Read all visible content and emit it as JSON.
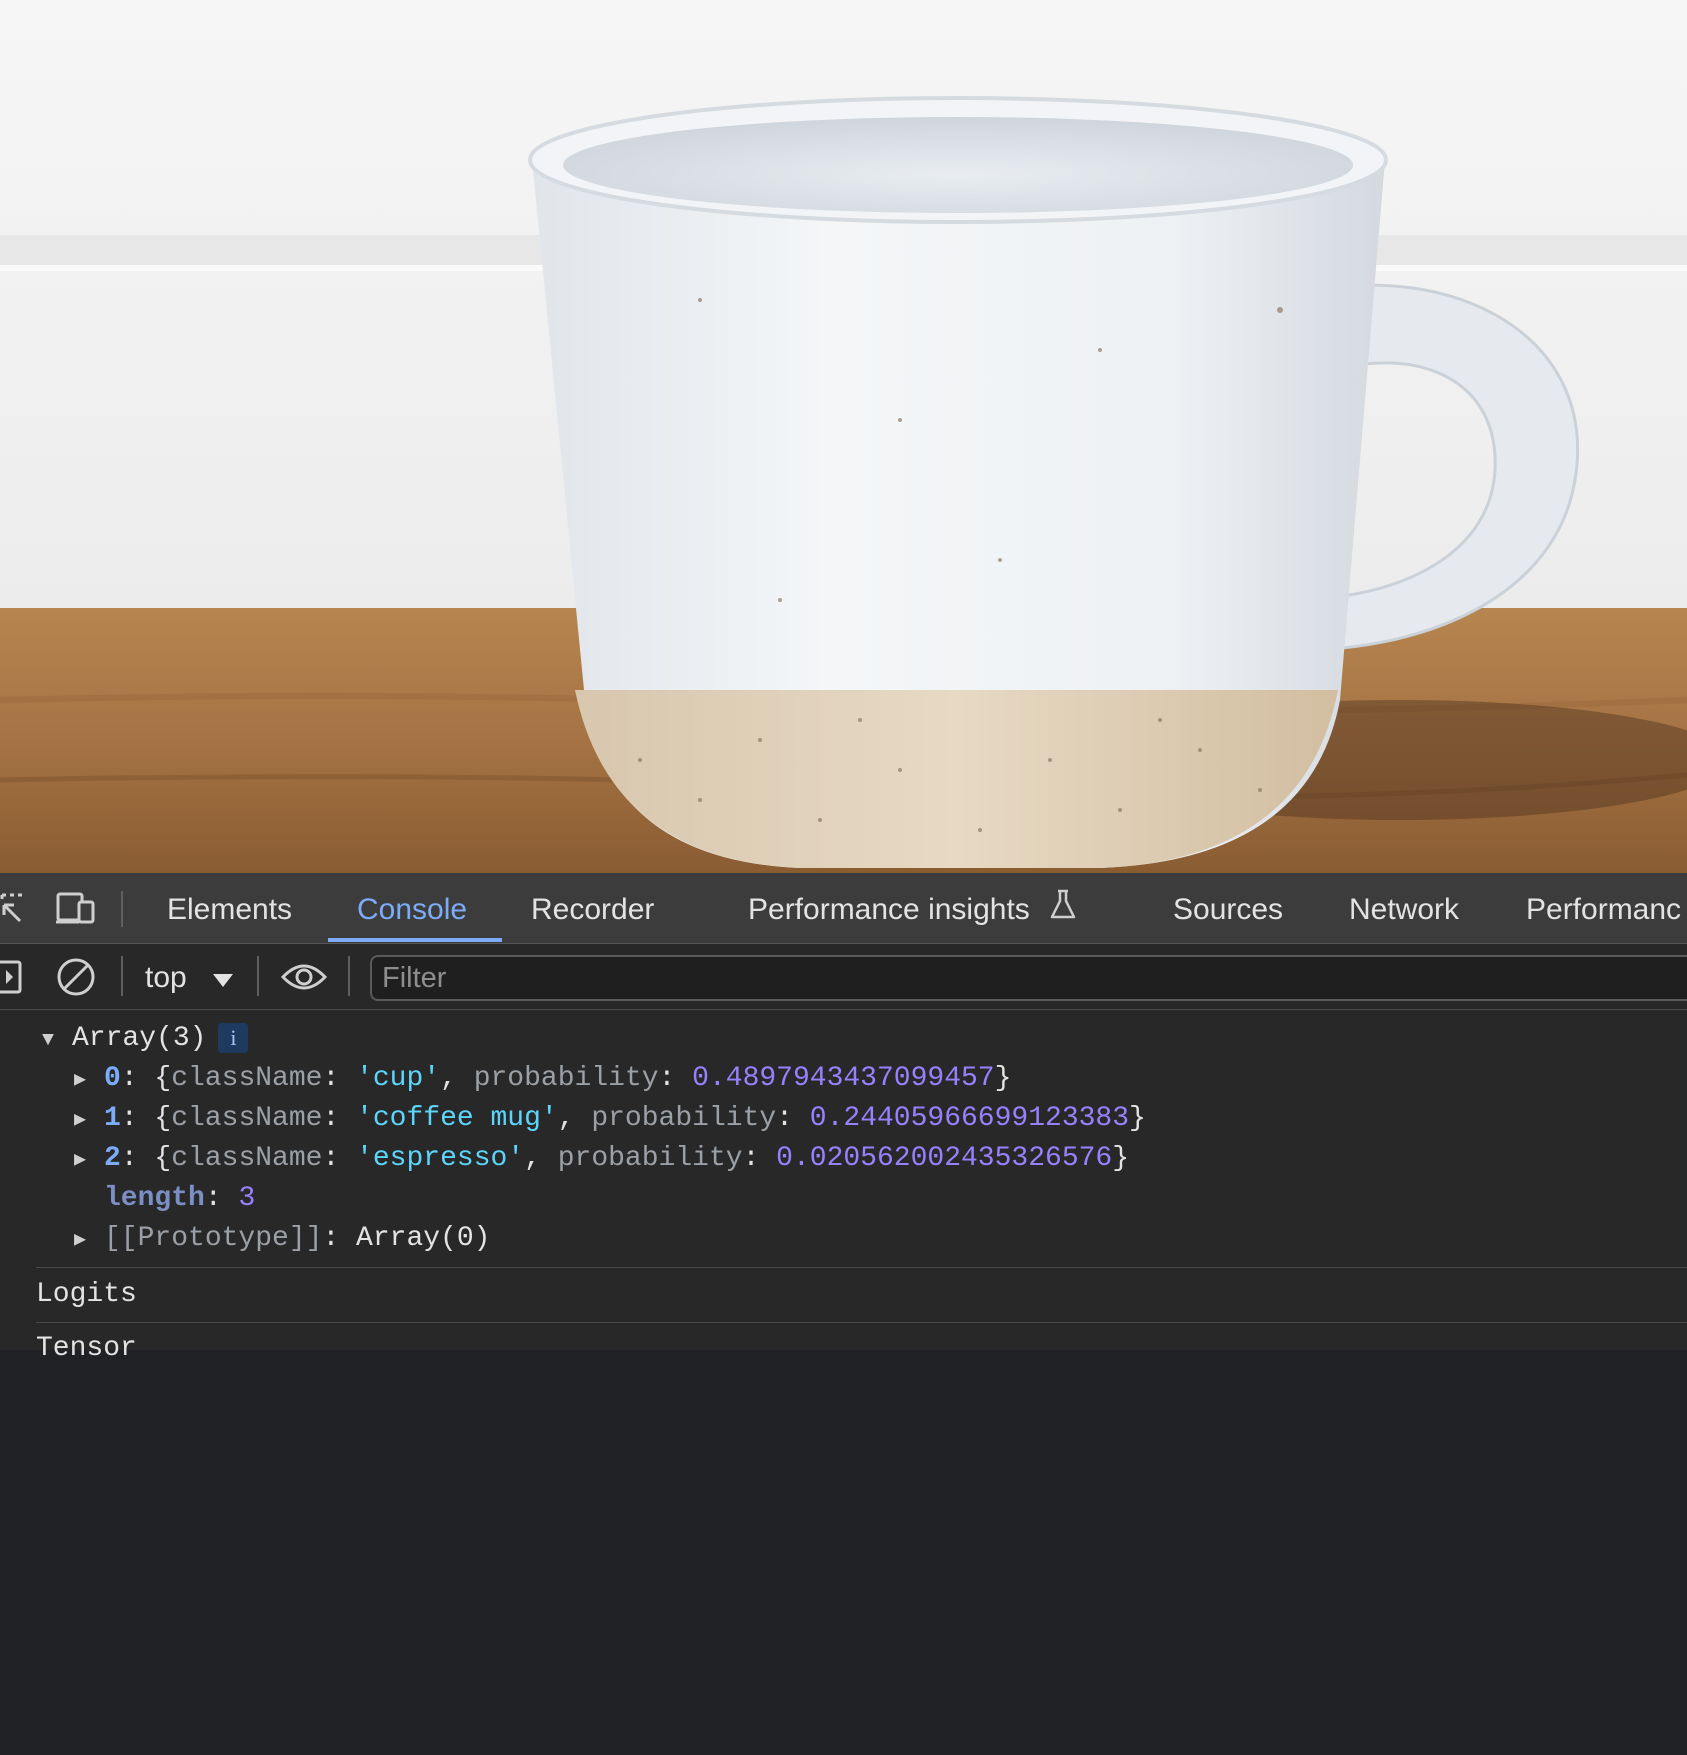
{
  "devtools": {
    "tabs": [
      {
        "label": "Elements"
      },
      {
        "label": "Console"
      },
      {
        "label": "Recorder"
      },
      {
        "label": "Performance insights"
      },
      {
        "label": "Sources"
      },
      {
        "label": "Network"
      },
      {
        "label": "Performanc"
      }
    ],
    "active_tab": "Console",
    "toolbar": {
      "context": "top",
      "filter_placeholder": "Filter"
    },
    "console": {
      "array_header": "Array(3)",
      "info_badge": "i",
      "entries": [
        {
          "index": "0",
          "className": "'cup'",
          "probability": "0.4897943437099457"
        },
        {
          "index": "1",
          "className": "'coffee mug'",
          "probability": "0.24405966699123383"
        },
        {
          "index": "2",
          "className": "'espresso'",
          "probability": "0.020562002435326576"
        }
      ],
      "key_className": "className",
      "key_probability": "probability",
      "length_key": "length",
      "length_value": "3",
      "prototype_key": "[[Prototype]]",
      "prototype_value": "Array(0)",
      "log_1": "Logits",
      "log_2": "Tensor"
    }
  },
  "colors": {
    "accent": "#7cacf8",
    "string": "#5cd5fb",
    "number": "#9980ff",
    "panel_bg": "#282828",
    "tabbar_bg": "#3c3c3c"
  }
}
